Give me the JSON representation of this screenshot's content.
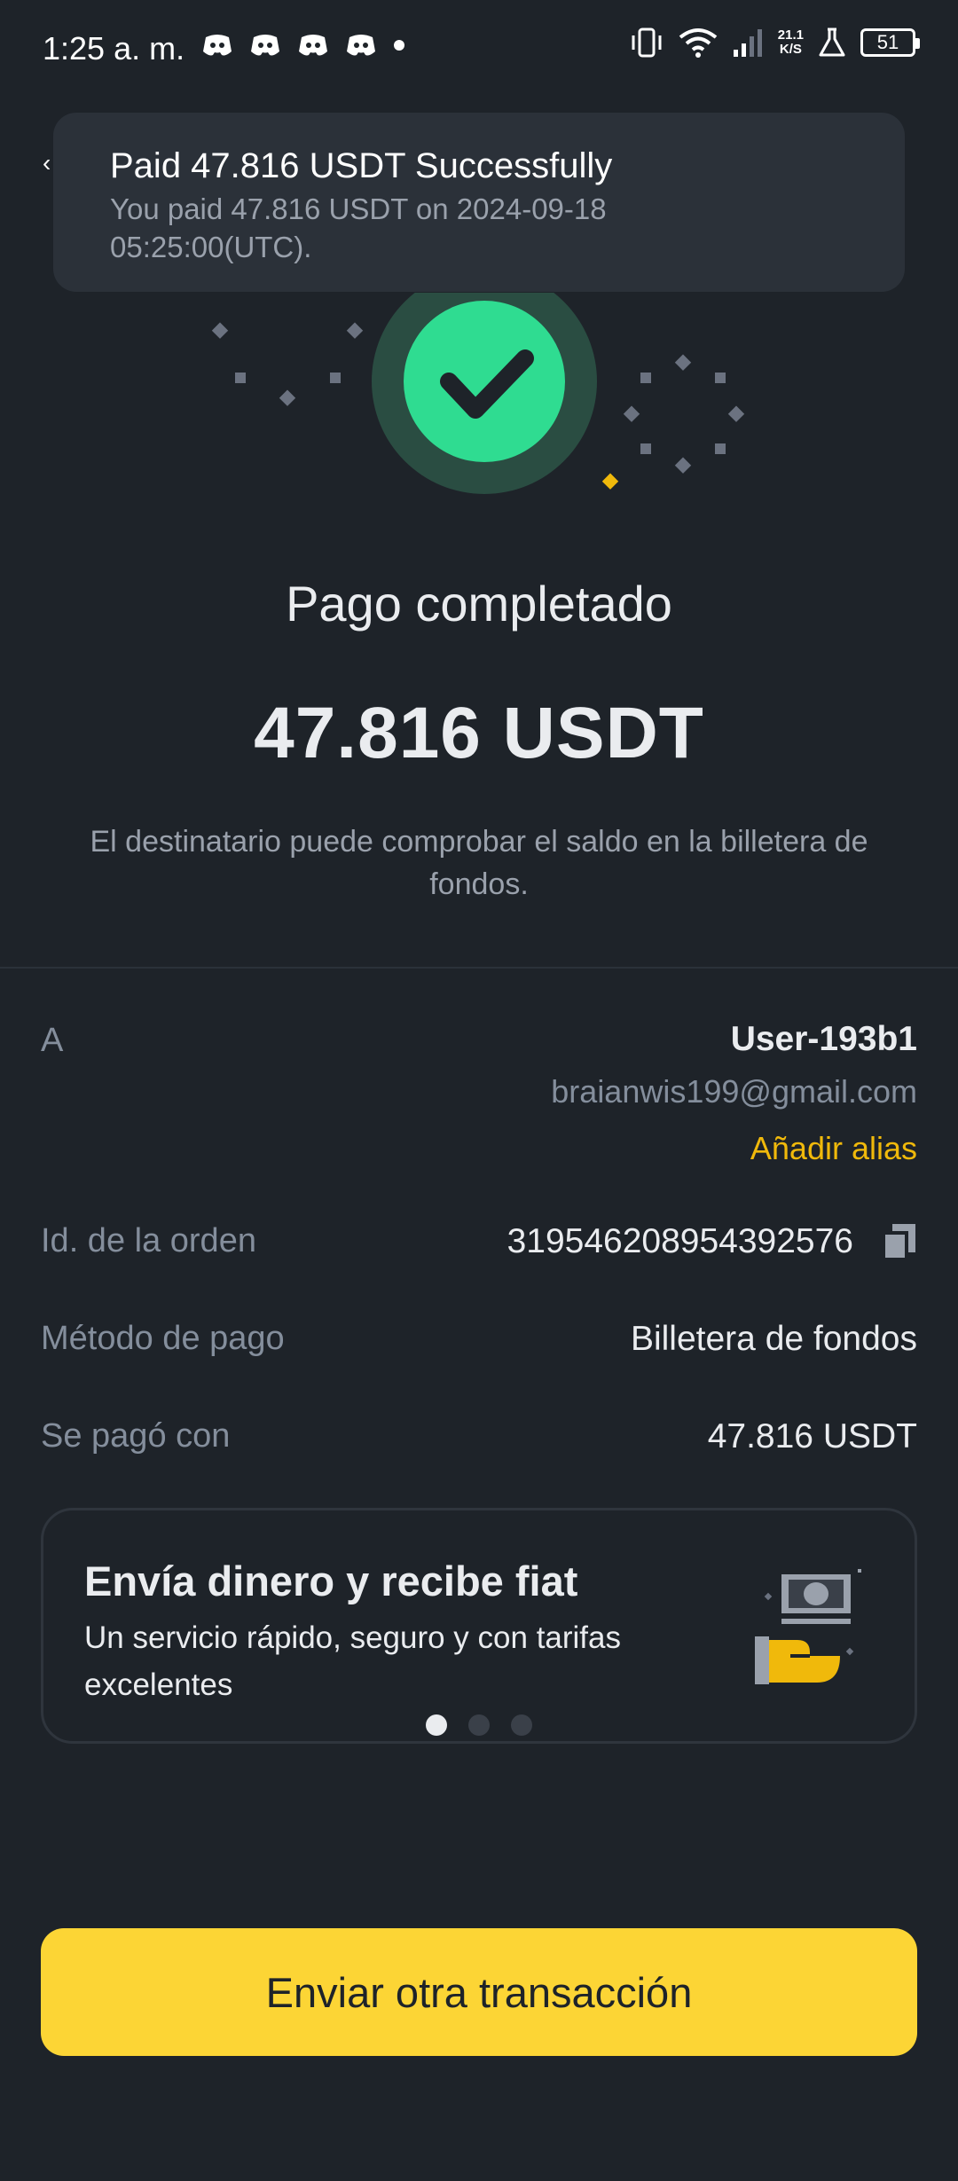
{
  "status_bar": {
    "time": "1:25 a. m.",
    "net_speed_value": "21.1",
    "net_speed_unit": "K/S",
    "battery": "51"
  },
  "toast": {
    "title": "Paid 47.816 USDT Successfully",
    "message": "You paid 47.816 USDT on 2024-09-18 05:25:00(UTC)."
  },
  "result": {
    "title": "Pago completado",
    "amount": "47.816 USDT",
    "note": "El destinatario puede comprobar el saldo en la billetera de fondos."
  },
  "details": {
    "recipient_label": "A",
    "recipient_name": "User-193b1",
    "recipient_email": "braianwis199@gmail.com",
    "add_alias": "Añadir alias",
    "order_label": "Id. de la orden",
    "order_id": "319546208954392576",
    "method_label": "Método de pago",
    "method_value": "Billetera de fondos",
    "paid_with_label": "Se pagó con",
    "paid_with_value": "47.816 USDT"
  },
  "promo": {
    "title": "Envía dinero y recibe fiat",
    "subtitle": "Un servicio rápido, seguro y con tarifas excelentes",
    "active_slide": 1,
    "slide_count": 3
  },
  "cta": {
    "label": "Enviar otra transacción"
  },
  "colors": {
    "background": "#1e2329",
    "success": "#2ebd85",
    "accent": "#fcd535",
    "alias": "#f0b90b"
  }
}
